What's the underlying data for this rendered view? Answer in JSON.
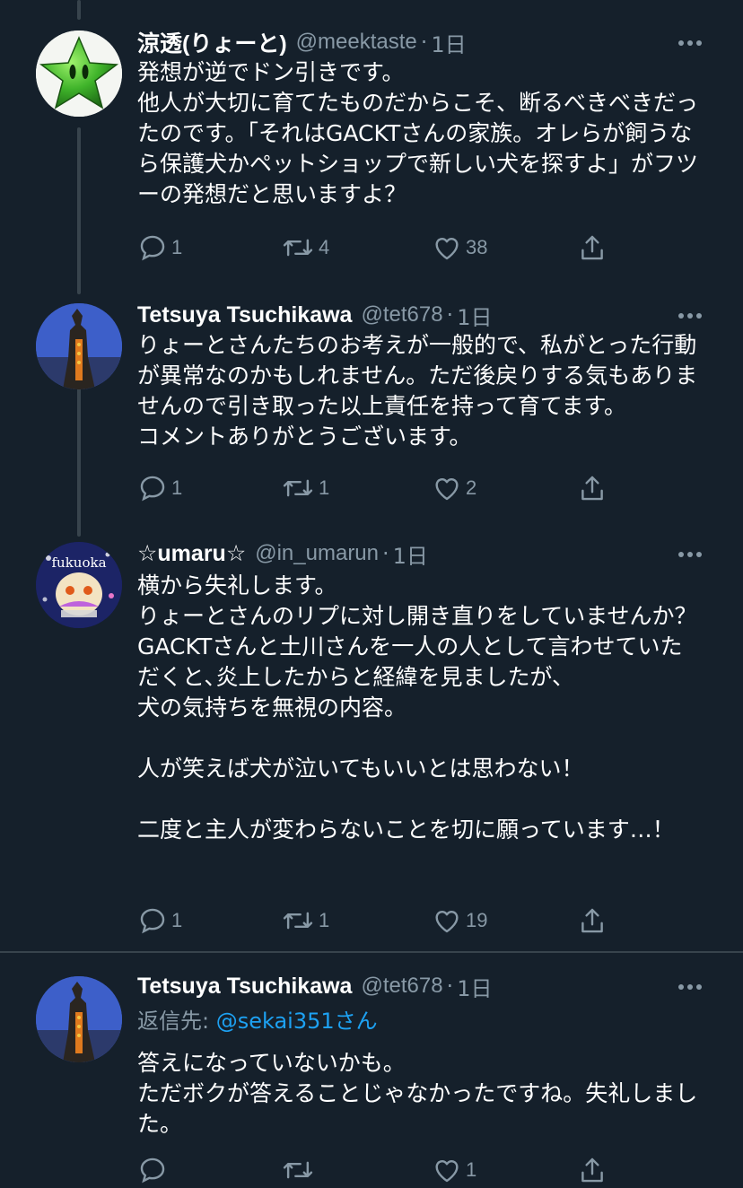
{
  "tweets": [
    {
      "name": "涼透(りょーと)",
      "handle": "@meektaste",
      "sep": "·",
      "time": "1日",
      "text": "発想が逆でドン引きです。\n他人が大切に育てたものだからこそ、断るべきべきだったのです。「それはGACKTさんの家族。オレらが飼うなら保護犬かペットショップで新しい犬を探すよ」がフツーの発想だと思いますよ？",
      "replies": "1",
      "retweets": "4",
      "likes": "38"
    },
    {
      "name": "Tetsuya Tsuchikawa",
      "handle": "@tet678",
      "sep": "·",
      "time": "1日",
      "text": "りょーとさんたちのお考えが一般的で、私がとった行動が異常なのかもしれません。ただ後戻りする気もありませんので引き取った以上責任を持って育てます。\nコメントありがとうございます。",
      "replies": "1",
      "retweets": "1",
      "likes": "2"
    },
    {
      "name": "☆umaru☆",
      "handle": "@in_umarun",
      "sep": "·",
      "time": "1日",
      "text": "横から失礼します。\nりょーとさんのリプに対し開き直りをしていませんか？\nGACKTさんと土川さんを一人の人として言わせていただくと､炎上したからと経緯を見ましたが、\n犬の気持ちを無視の内容。\n\n人が笑えば犬が泣いてもいいとは思わない！\n\n二度と主人が変わらないことを切に願っています…！",
      "avatar_text": "fukuoka",
      "replies": "1",
      "retweets": "1",
      "likes": "19"
    },
    {
      "name": "Tetsuya Tsuchikawa",
      "handle": "@tet678",
      "sep": "·",
      "time": "1日",
      "reply_label": "返信先: ",
      "reply_mention": "@sekai351さん",
      "text": "答えになっていないかも。\nただボクが答えることじゃなかったですね。失礼しました。",
      "replies": "",
      "retweets": "",
      "likes": "1"
    }
  ],
  "icons": {
    "reply": "speech-bubble-icon",
    "retweet": "retweet-arrows-icon",
    "like": "heart-icon",
    "share": "share-upload-icon",
    "more": "more-dots-icon"
  },
  "colors": {
    "background": "#15202b",
    "secondary_text": "#8899a6",
    "mention": "#1da1f2",
    "divider": "#38444d"
  }
}
